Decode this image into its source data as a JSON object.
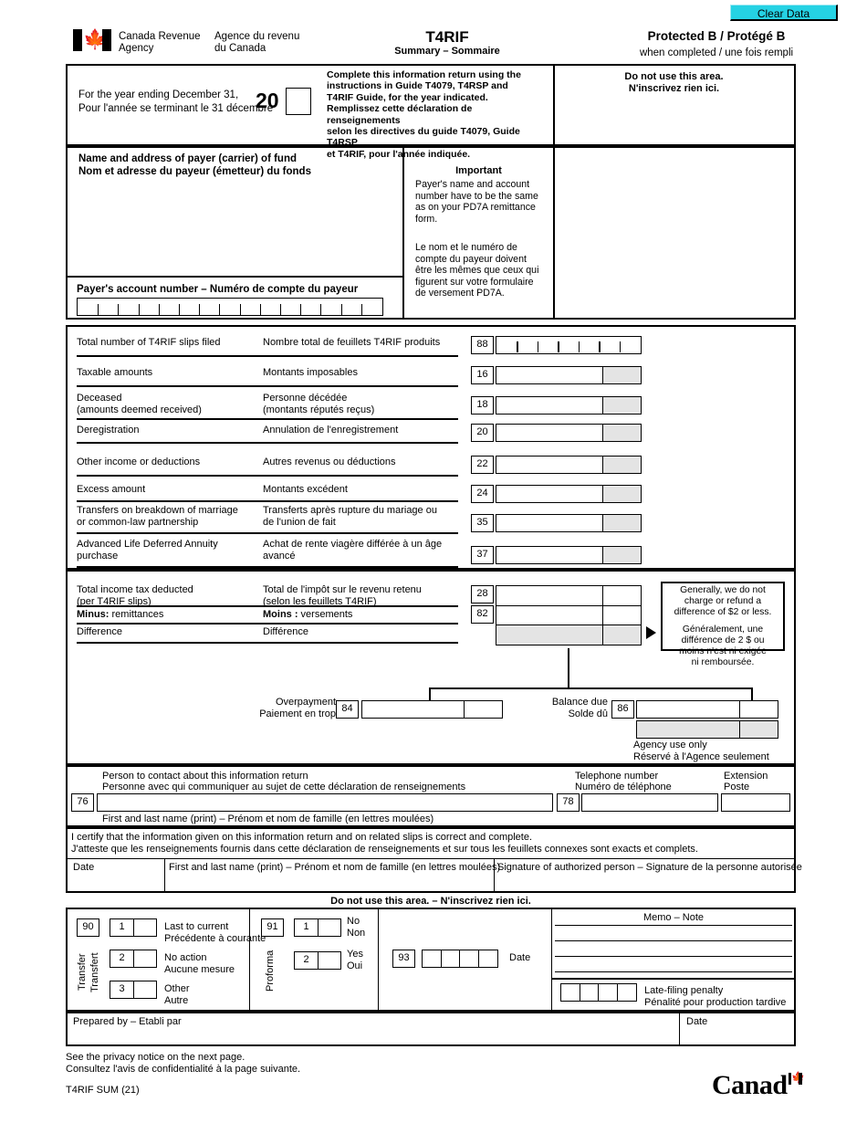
{
  "clear_button": {
    "label": "Clear Data",
    "color": "#25d2e4"
  },
  "header": {
    "agency_en": "Canada Revenue\nAgency",
    "agency_en_l1": "Canada Revenue",
    "agency_en_l2": "Agency",
    "agency_fr_l1": "Agence du revenu",
    "agency_fr_l2": "du Canada",
    "form_title": "T4RIF",
    "form_subtitle": "Summary  –  Sommaire",
    "protected": "Protected B / Protégé B",
    "protected_sub": "when completed / une fois rempli"
  },
  "year_section": {
    "label_en": "For the year ending December 31,",
    "label_fr": "Pour l'année se terminant le 31 décembre",
    "century": "20",
    "year_value": "",
    "instructions_en_l1": "Complete this information return using the",
    "instructions_en_l2": "instructions in Guide T4079, T4RSP and",
    "instructions_en_l3": "T4RIF Guide, for the year indicated.",
    "instructions_fr_l1": "Remplissez cette déclaration de renseignements",
    "instructions_fr_l2": "selon les directives du guide T4079, Guide T4RSP",
    "instructions_fr_l3": "et T4RIF, pour l'année indiquée.",
    "do_not_use_en": "Do not use this area.",
    "do_not_use_fr": "N'inscrivez rien ici."
  },
  "payer_section": {
    "name_en": "Name and address of payer (carrier) of fund",
    "name_fr": "Nom et adresse du payeur (émetteur) du fonds",
    "name_value": "",
    "important_title": "Important",
    "important_en_l1": "Payer's name and account",
    "important_en_l2": "number have to be the same",
    "important_en_l3": "as on your PD7A remittance",
    "important_en_l4": "form.",
    "important_fr_l1": "Le nom et le numéro de",
    "important_fr_l2": "compte du payeur doivent",
    "important_fr_l3": "être les mêmes que ceux qui",
    "important_fr_l4": "figurent sur votre formulaire",
    "important_fr_l5": "de versement PD7A.",
    "account_label": "Payer's account number  –  Numéro de compte du payeur",
    "account_value": "",
    "account_cells": 15
  },
  "amounts": [
    {
      "box": "88",
      "label_en": "Total number of T4RIF slips filed",
      "label_en_l2": "",
      "label_fr": "Nombre total de feuillets T4RIF produits",
      "label_fr_l2": "",
      "value": "",
      "type": "count",
      "cells": 7
    },
    {
      "box": "16",
      "label_en": "Taxable amounts",
      "label_en_l2": "",
      "label_fr": "Montants imposables",
      "label_fr_l2": "",
      "value": "",
      "type": "amount"
    },
    {
      "box": "18",
      "label_en": "Deceased",
      "label_en_l2": "(amounts deemed received)",
      "label_fr": "Personne décédée",
      "label_fr_l2": "(montants réputés reçus)",
      "value": "",
      "type": "amount"
    },
    {
      "box": "20",
      "label_en": "Deregistration",
      "label_en_l2": "",
      "label_fr": "Annulation de l'enregistrement",
      "label_fr_l2": "",
      "value": "",
      "type": "amount"
    },
    {
      "box": "22",
      "label_en": "Other income or deductions",
      "label_en_l2": "",
      "label_fr": "Autres revenus ou déductions",
      "label_fr_l2": "",
      "value": "",
      "type": "amount"
    },
    {
      "box": "24",
      "label_en": "Excess amount",
      "label_en_l2": "",
      "label_fr": "Montants excédent",
      "label_fr_l2": "",
      "value": "",
      "type": "amount"
    },
    {
      "box": "35",
      "label_en": "Transfers on breakdown of marriage",
      "label_en_l2": "or common-law partnership",
      "label_fr": "Transferts après rupture du mariage ou",
      "label_fr_l2": "de l'union de fait",
      "value": "",
      "type": "amount"
    },
    {
      "box": "37",
      "label_en": "Advanced Life Deferred Annuity",
      "label_en_l2": "purchase",
      "label_fr": "Achat de rente viagère différée à un âge",
      "label_fr_l2": "avancé",
      "value": "",
      "type": "amount"
    }
  ],
  "tax_section": {
    "rows": [
      {
        "box": "28",
        "label_en": "Total income tax deducted",
        "label_en_l2": "(per T4RIF slips)",
        "label_fr": "Total de l'impôt sur le revenu retenu",
        "label_fr_l2": "(selon les feuillets T4RIF)",
        "value": ""
      },
      {
        "box": "82",
        "label_en_bold": "Minus:",
        "label_en": " remittances",
        "label_en_l2": "",
        "label_fr_bold": "Moins :",
        "label_fr": " versements",
        "label_fr_l2": "",
        "value": ""
      },
      {
        "box": "",
        "label_en": "Difference",
        "label_en_l2": "",
        "label_fr": "Différence",
        "label_fr_l2": "",
        "value": "",
        "readonly": true
      }
    ],
    "note_en_l1": "Generally, we do not",
    "note_en_l2": "charge or refund a",
    "note_en_l3": "difference of $2 or less.",
    "note_fr_l1": "Généralement, une",
    "note_fr_l2": "différence de 2 $ ou",
    "note_fr_l3": "moins n'est ni exigée",
    "note_fr_l4": "ni remboursée."
  },
  "settlement": {
    "overpayment_en": "Overpayment",
    "overpayment_fr": "Paiement en trop",
    "overpayment_box": "84",
    "overpayment_value": "",
    "balance_due_en": "Balance due",
    "balance_due_fr": "Solde dû",
    "balance_due_box": "86",
    "balance_due_value": "",
    "agency_use_en": "Agency use only",
    "agency_use_fr": "Réservé à l'Agence seulement",
    "agency_use_value": ""
  },
  "contact": {
    "person_en": "Person to contact about this information return",
    "person_fr": "Personne avec qui communiquer au sujet de cette déclaration de renseignements",
    "person_box": "76",
    "person_value": "",
    "name_hint": "First and last name (print) – Prénom et nom de famille (en lettres moulées)",
    "phone_en": "Telephone number",
    "phone_fr": "Numéro de téléphone",
    "phone_box": "78",
    "phone_value": "",
    "ext_en": "Extension",
    "ext_fr": "Poste",
    "ext_value": ""
  },
  "certification": {
    "text_en": "I certify that the information given on this information return and on related slips is correct and complete.",
    "text_fr": "J'atteste que les renseignements fournis dans cette déclaration de renseignements et sur tous les feuillets connexes sont exacts et complets.",
    "date_label": "Date",
    "date_value": "",
    "name_label": "First and last name (print) – Prénom et nom de famille (en lettres moulées)",
    "name_value": "",
    "signature_label": "Signature of authorized person – Signature de la personne autorisée",
    "signature_value": ""
  },
  "admin": {
    "do_not_use": "Do not use this area. – N'inscrivez rien ici.",
    "transfer_label_en": "Transfer",
    "transfer_label_fr": "Transfert",
    "transfer_box": "90",
    "transfer_options": [
      {
        "num": "1",
        "label_en": "Last to current",
        "label_fr": "Précédente à courante",
        "value": ""
      },
      {
        "num": "2",
        "label_en": "No action",
        "label_fr": "Aucune mesure",
        "value": ""
      },
      {
        "num": "3",
        "label_en": "Other",
        "label_fr": "Autre",
        "value": ""
      }
    ],
    "proforma_label": "Proforma",
    "proforma_box": "91",
    "proforma_options": [
      {
        "num": "1",
        "label_en": "No",
        "label_fr": "Non",
        "value": ""
      },
      {
        "num": "2",
        "label_en": "Yes",
        "label_fr": "Oui",
        "value": ""
      }
    ],
    "date_box": "93",
    "date_label": "Date",
    "date_cells": 4,
    "date_value": "",
    "memo_title": "Memo – Note",
    "memo_lines": [
      "",
      "",
      "",
      ""
    ],
    "penalty_en": "Late-filing penalty",
    "penalty_fr": "Pénalité pour production tardive",
    "penalty_cells": 4,
    "penalty_value": ""
  },
  "prepared": {
    "label": "Prepared by – Etabli par",
    "value": "",
    "date_label": "Date",
    "date_value": ""
  },
  "footer": {
    "privacy_en": "See the privacy notice on the next page.",
    "privacy_fr": "Consultez l'avis de confidentialité à la page suivante.",
    "form_code": "T4RIF SUM (21)",
    "wordmark": "Canad"
  }
}
